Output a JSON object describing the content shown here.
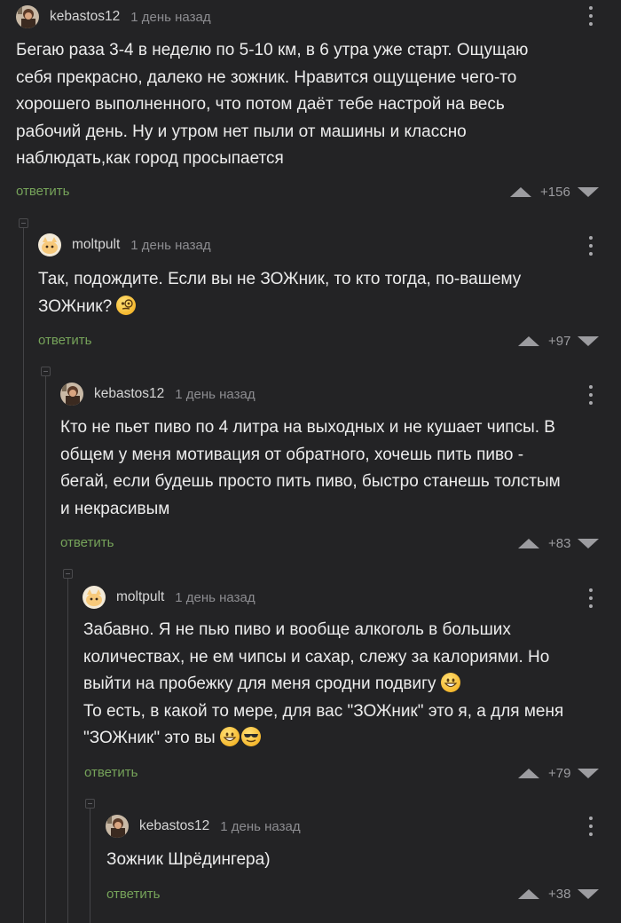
{
  "reply_label": "ответить",
  "colors": {
    "background": "#232325",
    "reply": "#76a35a",
    "meta": "#8c8c90"
  },
  "comments": [
    {
      "author": "kebastos12",
      "time": "1 день назад",
      "avatar": "user-avatar-photo",
      "text": [
        "Бегаю раза 3-4 в неделю по 5-10 км, в 6 утра уже старт. Ощущаю",
        "себя прекрасно, далеко не зожник. Нравится ощущение чего-то",
        "хорошего выполненного, что потом даёт тебе настрой на весь",
        "рабочий день. Ну и утром нет пыли от машины и классно",
        "наблюдать,как город просыпается"
      ],
      "score": "+156"
    },
    {
      "author": "moltpult",
      "time": "1 день назад",
      "avatar": "cat-avatar",
      "text": [
        "Так, подождите. Если вы не ЗОЖник, то кто тогда, по-вашему",
        "ЗОЖник?"
      ],
      "score": "+97"
    },
    {
      "author": "kebastos12",
      "time": "1 день назад",
      "avatar": "user-avatar-photo",
      "text": [
        "Кто не пьет пиво по 4 литра на выходных и не кушает чипсы. В",
        "общем у меня мотивация от обратного, хочешь пить пиво -",
        "бегай, если будешь просто пить пиво, быстро станешь толстым",
        "и некрасивым"
      ],
      "score": "+83"
    },
    {
      "author": "moltpult",
      "time": "1 день назад",
      "avatar": "cat-avatar",
      "text": [
        "Забавно. Я не пью пиво и вообще алкоголь в больших",
        "количествах, не ем чипсы и сахар, слежу за калориями. Но",
        "выйти на пробежку для меня сродни подвигу",
        "То есть, в какой то мере, для вас \"ЗОЖник\" это я, а для меня",
        "\"ЗОЖник\" это вы"
      ],
      "score": "+79"
    },
    {
      "author": "kebastos12",
      "time": "1 день назад",
      "avatar": "user-avatar-photo",
      "text": [
        "Зожник Шрёдингера)"
      ],
      "score": "+38"
    }
  ]
}
